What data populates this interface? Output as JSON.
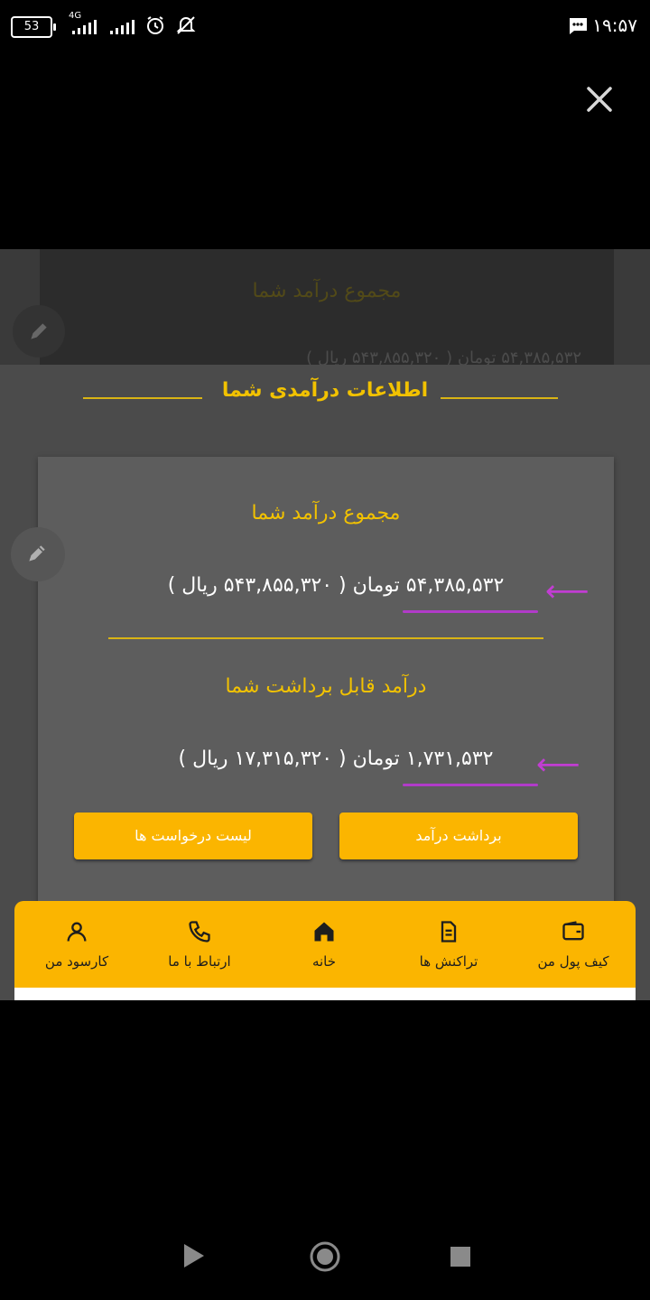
{
  "status_bar": {
    "battery": "53",
    "network": "4G",
    "time": "۱۹:۵۷"
  },
  "background_card": {
    "title": "مجموع درآمد شما",
    "amount_line": "۵۴,۳۸۵,۵۳۲ تومان ( ۵۴۳,۸۵۵,۳۲۰ ریال )"
  },
  "sheet": {
    "title": "اطلاعات درآمدی شما"
  },
  "income_card": {
    "total_title": "مجموع درآمد شما",
    "total_amount": "۵۴,۳۸۵,۵۳۲",
    "total_rest": " تومان ( ۵۴۳,۸۵۵,۳۲۰ ریال )",
    "withdrawable_title": "درآمد قابل برداشت شما",
    "withdrawable_amount": "۱,۷۳۱,۵۳۲",
    "withdrawable_rest": " تومان ( ۱۷,۳۱۵,۳۲۰ ریال )",
    "withdraw_button": "برداشت درآمد",
    "requests_button": "لیست درخواست ها"
  },
  "bottom_nav": {
    "items": [
      {
        "label": "کیف پول من",
        "icon": "wallet-icon"
      },
      {
        "label": "تراکنش ها",
        "icon": "document-icon"
      },
      {
        "label": "خانه",
        "icon": "home-icon"
      },
      {
        "label": "ارتباط با ما",
        "icon": "phone-icon"
      },
      {
        "label": "کارسود من",
        "icon": "user-icon"
      }
    ]
  },
  "colors": {
    "accent": "#fbb500",
    "title_gold": "#f2c200",
    "annotation": "#c13dd2"
  }
}
